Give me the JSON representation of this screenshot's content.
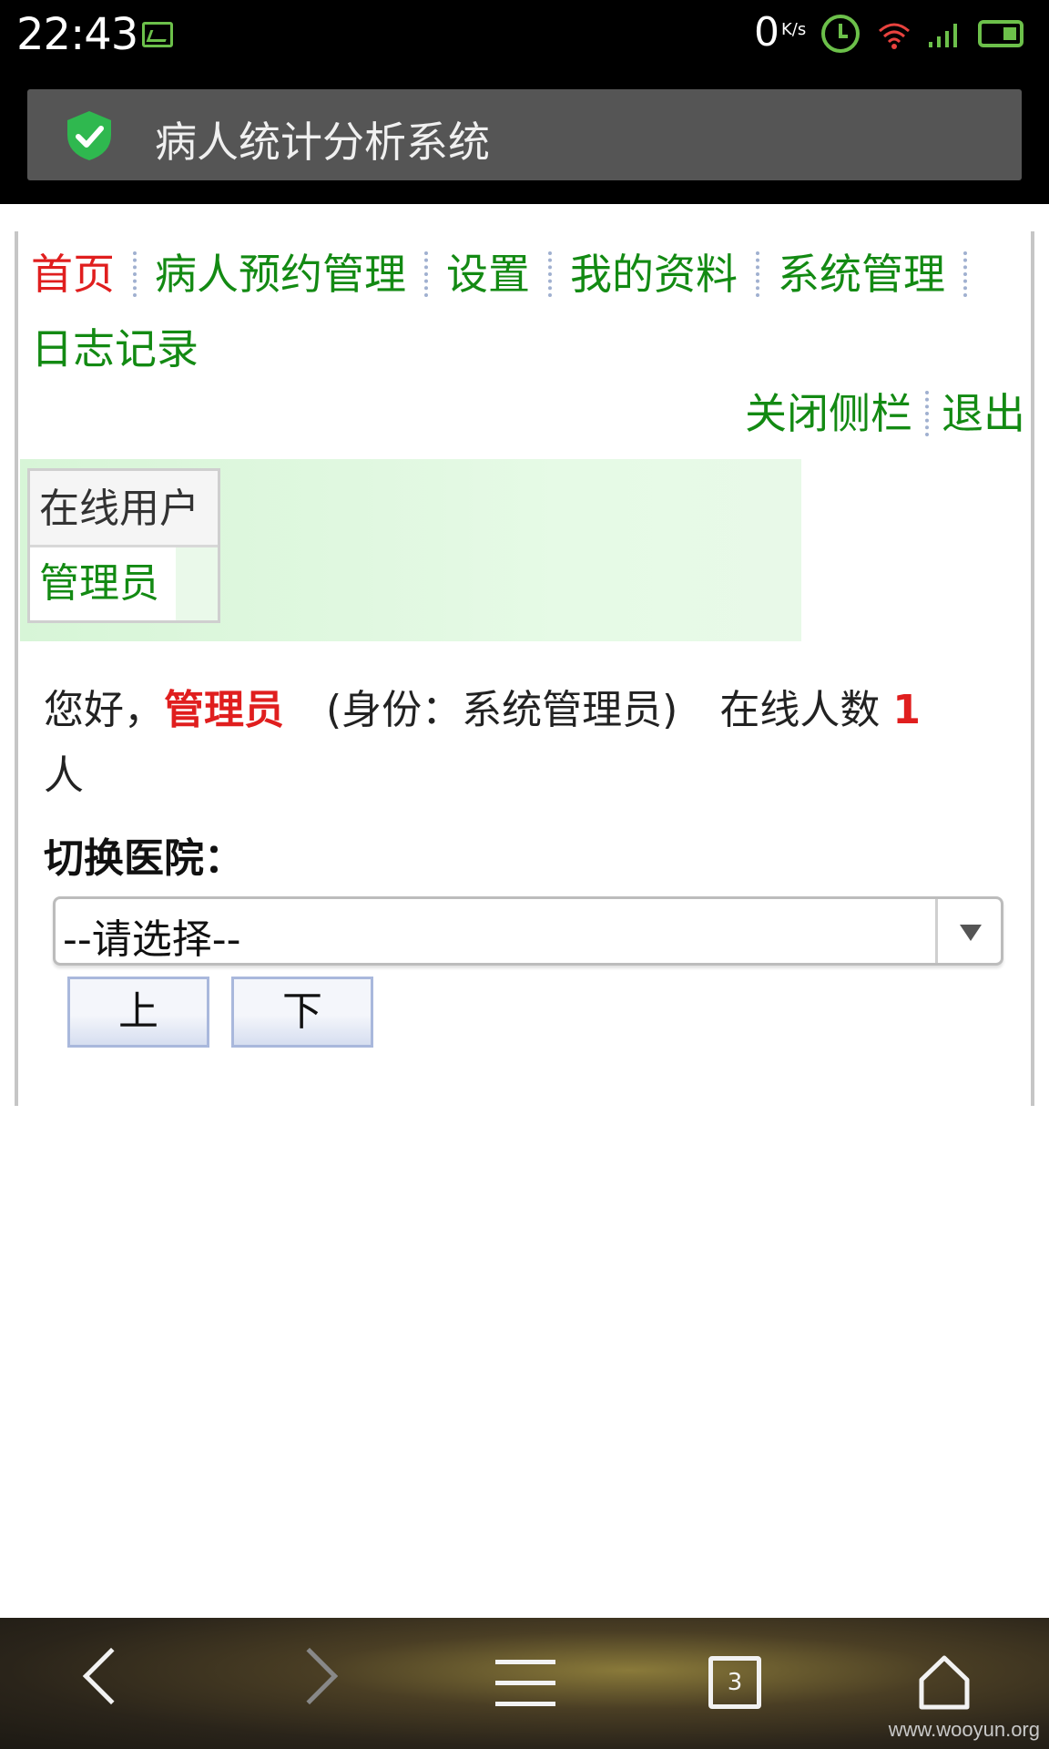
{
  "status_bar": {
    "time": "22:43",
    "net_speed": "0",
    "net_speed_unit": "K/s",
    "icons": [
      "image-icon",
      "alarm-icon",
      "wifi-icon",
      "signal-icon",
      "battery-icon"
    ]
  },
  "title_bar": {
    "title": "病人统计分析系统",
    "icon": "shield-check-icon"
  },
  "nav": {
    "items": [
      {
        "label": "首页",
        "active": true
      },
      {
        "label": "病人预约管理",
        "active": false
      },
      {
        "label": "设置",
        "active": false
      },
      {
        "label": "我的资料",
        "active": false
      },
      {
        "label": "系统管理",
        "active": false
      },
      {
        "label": "日志记录",
        "active": false
      }
    ]
  },
  "side_links": {
    "close_sidebar": "关闭侧栏",
    "logout": "退出"
  },
  "online_users": {
    "header": "在线用户",
    "users": [
      "管理员"
    ]
  },
  "greeting": {
    "prefix": "您好，",
    "name": "管理员",
    "role": "(身份：系统管理员)",
    "online_label": "在线人数",
    "online_count": "1",
    "online_unit": "人"
  },
  "switch_hospital": {
    "label": "切换医院：",
    "selected": "--请选择--"
  },
  "buttons": {
    "up": "上",
    "down": "下"
  },
  "bottom_nav": {
    "tab_count": "3",
    "watermark": "www.wooyun.org"
  },
  "colors": {
    "nav_link": "#138a13",
    "nav_active": "#e01e1e",
    "highlight": "#e01e1e"
  }
}
